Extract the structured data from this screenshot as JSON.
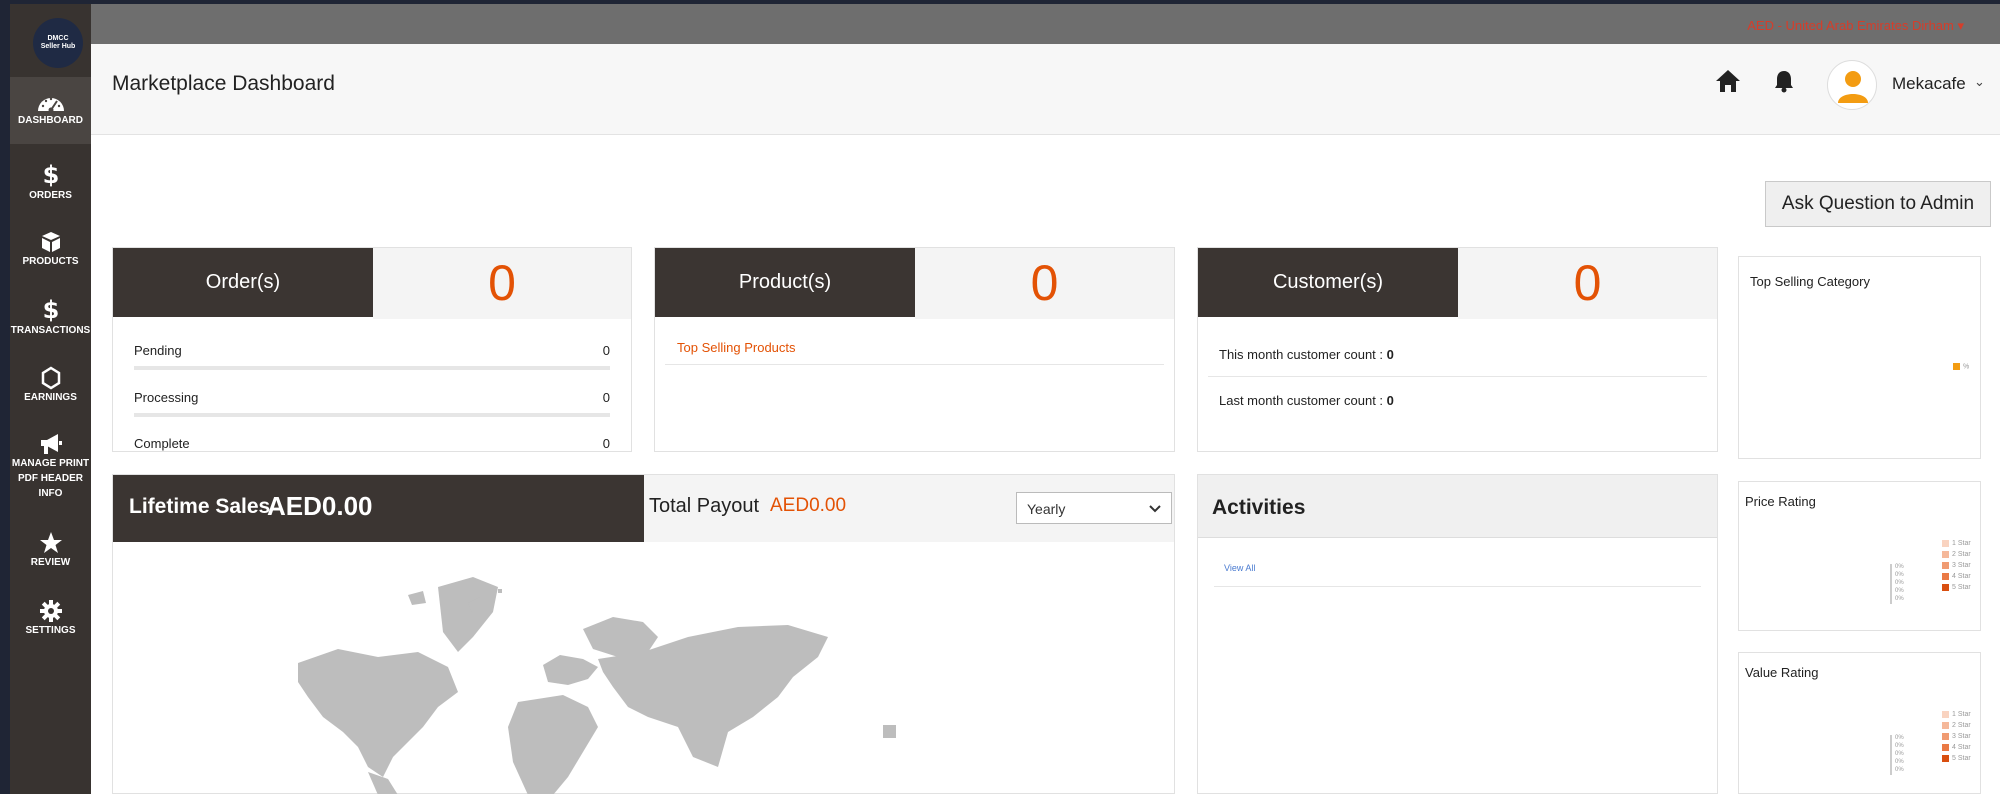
{
  "colors": {
    "accent": "#e35205",
    "sidebar": "#383330",
    "card_head": "#3b3532"
  },
  "logo": {
    "line1": "DMCC",
    "line2": "Seller Hub"
  },
  "sidebar": {
    "items": [
      {
        "label": "DASHBOARD",
        "icon": "speedometer-icon"
      },
      {
        "label": "ORDERS",
        "icon": "dollar-icon"
      },
      {
        "label": "PRODUCTS",
        "icon": "box-icon"
      },
      {
        "label": "TRANSACTIONS",
        "icon": "dollar-icon"
      },
      {
        "label": "EARNINGS",
        "icon": "hexagon-icon"
      },
      {
        "label_lines": [
          "MANAGE PRINT",
          "PDF HEADER",
          "INFO"
        ],
        "icon": "megaphone-icon"
      },
      {
        "label": "REVIEW",
        "icon": "star-icon"
      },
      {
        "label": "SETTINGS",
        "icon": "gear-icon"
      }
    ]
  },
  "topbar": {
    "currency": "AED - United Arab Emirates Dirham ▾"
  },
  "header": {
    "title": "Marketplace Dashboard",
    "username": "Mekacafe"
  },
  "ask_button": "Ask Question to Admin",
  "orders": {
    "title": "Order(s)",
    "count": "0",
    "rows": [
      {
        "label": "Pending",
        "value": "0"
      },
      {
        "label": "Processing",
        "value": "0"
      },
      {
        "label": "Complete",
        "value": "0"
      }
    ]
  },
  "products": {
    "title": "Product(s)",
    "count": "0",
    "link": "Top Selling Products"
  },
  "customers": {
    "title": "Customer(s)",
    "count": "0",
    "this_month_label": "This month customer count : ",
    "this_month_value": "0",
    "last_month_label": "Last month customer count : ",
    "last_month_value": "0"
  },
  "sales": {
    "lifetime_label": "Lifetime Sales",
    "lifetime_value": "AED0.00",
    "payout_label": "Total Payout",
    "payout_value": "AED0.00",
    "period_selected": "Yearly"
  },
  "activities": {
    "title": "Activities",
    "view_all": "View All"
  },
  "top_selling_category": {
    "title": "Top Selling Category",
    "legend": "%"
  },
  "price_rating": {
    "title": "Price Rating",
    "legend": [
      "1 Star",
      "2 Star",
      "3 Star",
      "4 Star",
      "5 Star"
    ],
    "legend_colors": [
      "#f9d3c0",
      "#f5b89a",
      "#f09b72",
      "#ea7a45",
      "#d94f10"
    ],
    "bar_labels": [
      "0%",
      "0%",
      "0%",
      "0%",
      "0%"
    ]
  },
  "value_rating": {
    "title": "Value Rating",
    "legend": [
      "1 Star",
      "2 Star",
      "3 Star",
      "4 Star",
      "5 Star"
    ],
    "legend_colors": [
      "#f9d3c0",
      "#f5b89a",
      "#f09b72",
      "#ea7a45",
      "#d94f10"
    ],
    "bar_labels": [
      "0%",
      "0%",
      "0%",
      "0%",
      "0%"
    ]
  }
}
